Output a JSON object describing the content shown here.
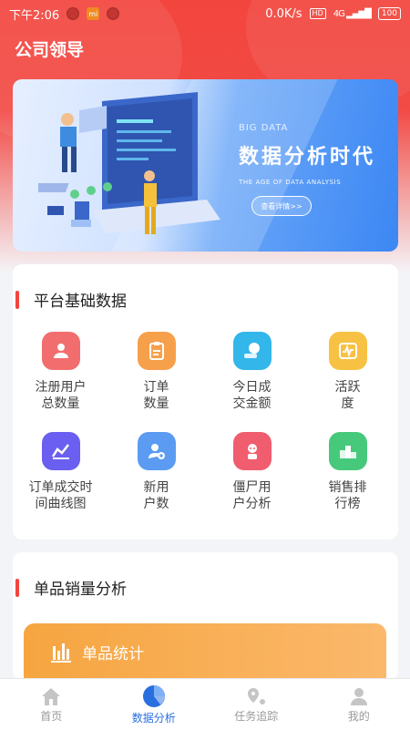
{
  "status_bar": {
    "time": "下午2:06",
    "speed": "0.0K/s",
    "hd": "HD",
    "network": "4G",
    "battery": "100"
  },
  "app": {
    "title": "公司领导"
  },
  "banner": {
    "small": "BIG DATA",
    "title": "数据分析时代",
    "subtitle": "THE AGE OF DATA ANALYSIS",
    "button": "查看详情>>"
  },
  "basic_section": {
    "title": "平台基础数据",
    "items": [
      {
        "label": "注册用户\n总数量",
        "icon": "users-icon",
        "color": "#f26e6e"
      },
      {
        "label": "订单\n数量",
        "icon": "clipboard-icon",
        "color": "#f7a04c"
      },
      {
        "label": "今日成\n交金额",
        "icon": "money-icon",
        "color": "#33b6ea"
      },
      {
        "label": "活跃\n度",
        "icon": "activity-icon",
        "color": "#f7c144"
      },
      {
        "label": "订单成交时\n间曲线图",
        "icon": "chart-line-icon",
        "color": "#6a5ff0"
      },
      {
        "label": "新用\n户数",
        "icon": "add-user-icon",
        "color": "#5b9bf2"
      },
      {
        "label": "僵尸用\n户分析",
        "icon": "zombie-user-icon",
        "color": "#f05d6e"
      },
      {
        "label": "销售排\n行榜",
        "icon": "podium-icon",
        "color": "#47c97c"
      }
    ]
  },
  "product_section": {
    "title": "单品销量分析",
    "stat_label": "单品统计"
  },
  "tabs": [
    {
      "label": "首页",
      "icon": "home-icon",
      "active": false
    },
    {
      "label": "数据分析",
      "icon": "pie-chart-icon",
      "active": true
    },
    {
      "label": "任务追踪",
      "icon": "location-icon",
      "active": false
    },
    {
      "label": "我的",
      "icon": "profile-icon",
      "active": false
    }
  ]
}
